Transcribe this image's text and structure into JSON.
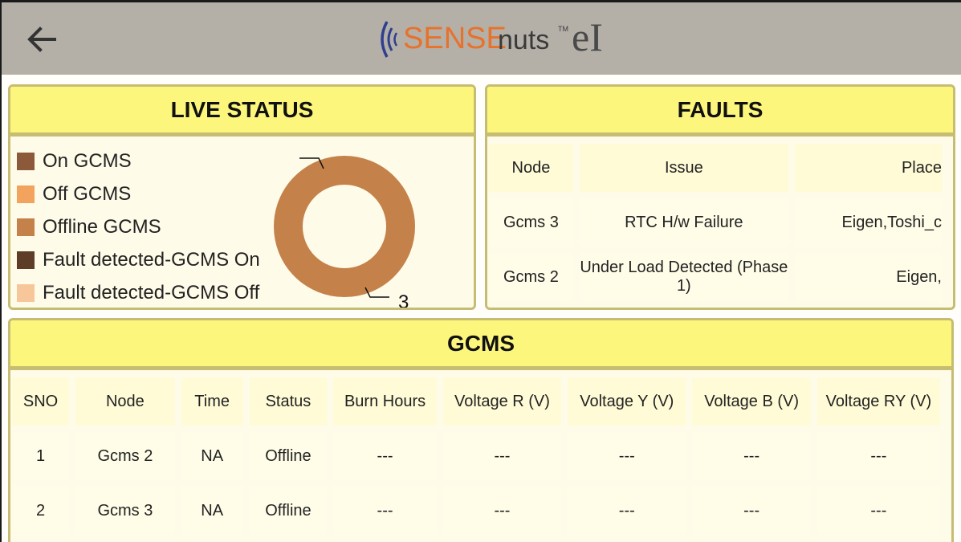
{
  "header": {
    "brand_sense": "SENSE",
    "brand_nuts": "nuts",
    "brand_tm": "TM",
    "brand_ei": "eI",
    "back_icon": "arrow-left-icon"
  },
  "colors": {
    "header_bg": "#b4b0a8",
    "panel_title_bg": "#fdf67c",
    "panel_border": "#c6bd72",
    "brand_orange": "#e8712b"
  },
  "live_status": {
    "title": "LIVE STATUS",
    "legend": [
      {
        "label": "On GCMS",
        "color": "#8c5a3a"
      },
      {
        "label": "Off GCMS",
        "color": "#f2a45e"
      },
      {
        "label": "Offline GCMS",
        "color": "#c4824a"
      },
      {
        "label": "Fault detected-GCMS On",
        "color": "#5e3d28"
      },
      {
        "label": "Fault detected-GCMS Off",
        "color": "#f7c79b"
      }
    ],
    "donut_label": "3"
  },
  "chart_data": {
    "type": "pie",
    "categories": [
      "On GCMS",
      "Off GCMS",
      "Offline GCMS",
      "Fault detected-GCMS On",
      "Fault detected-GCMS Off"
    ],
    "values": [
      0,
      0,
      3,
      0,
      0
    ],
    "legend_position": "left"
  },
  "faults": {
    "title": "FAULTS",
    "columns": [
      "Node",
      "Issue",
      "Place"
    ],
    "rows": [
      [
        "Gcms 3",
        "RTC H/w Failure",
        "Eigen,Toshi_c"
      ],
      [
        "Gcms 2",
        "Under Load Detected (Phase 1)",
        "Eigen,"
      ]
    ]
  },
  "gcms": {
    "title": "GCMS",
    "columns": [
      "SNO",
      "Node",
      "Time",
      "Status",
      "Burn Hours",
      "Voltage R (V)",
      "Voltage Y (V)",
      "Voltage B (V)",
      "Voltage RY (V)"
    ],
    "rows": [
      [
        "1",
        "Gcms 2",
        "NA",
        "Offline",
        "---",
        "---",
        "---",
        "---",
        "---"
      ],
      [
        "2",
        "Gcms 3",
        "NA",
        "Offline",
        "---",
        "---",
        "---",
        "---",
        "---"
      ]
    ]
  }
}
